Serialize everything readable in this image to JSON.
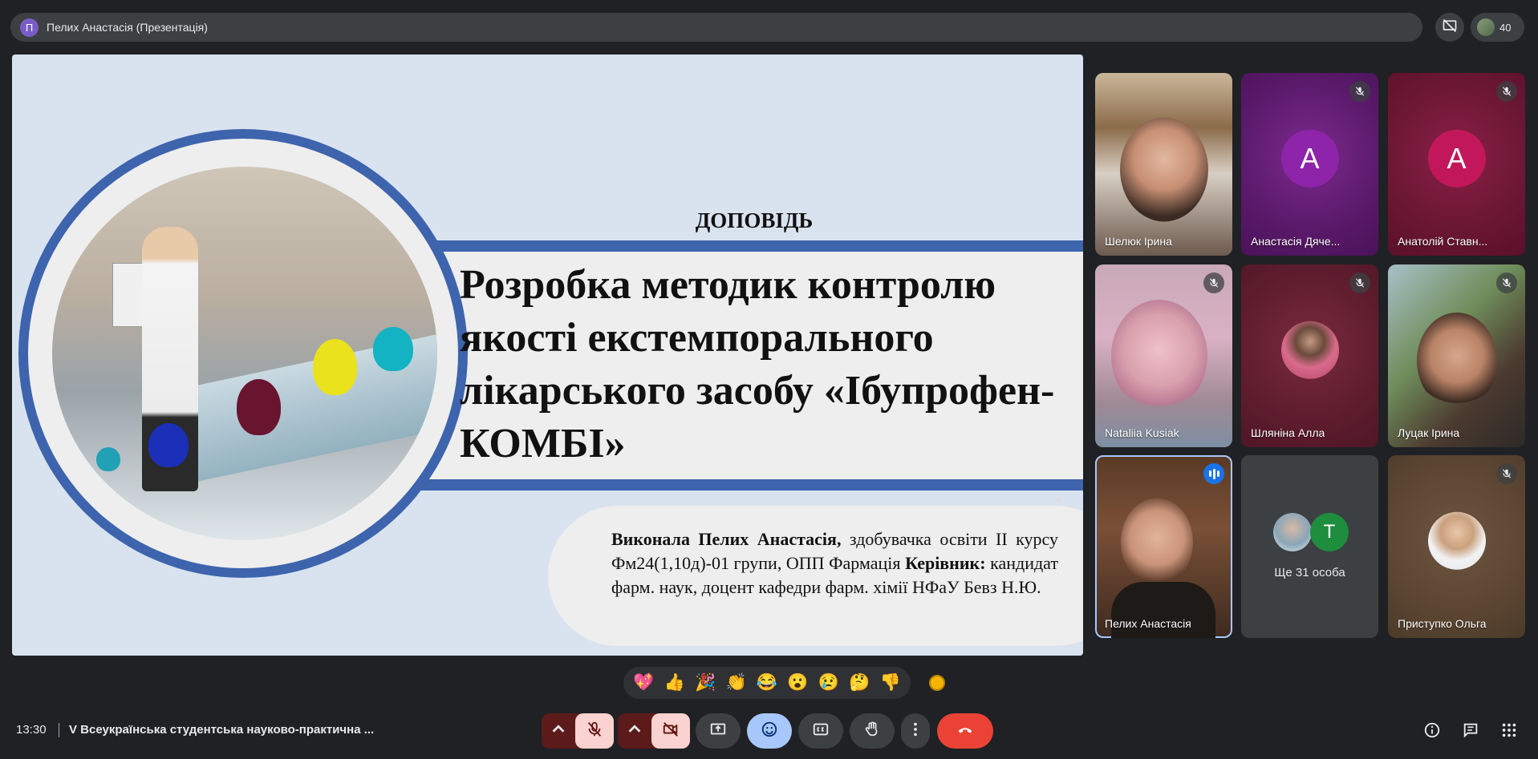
{
  "topbar": {
    "presenter_initial": "П",
    "title": "Пелих Анастасія (Презентація)",
    "participants_count": "40"
  },
  "slide": {
    "label": "ДОПОВІДЬ",
    "title": "Розробка методик контролю якості екстемпорального лікарського засобу «Ібупрофен-КОМБІ»",
    "author_bold": "Виконала Пелих Анастасія,",
    "author_rest": " здобувачка освіти ІІ курсу Фм24(1,10д)-01 групи, ОПП Фармація",
    "supervisor_bold": "Керівник:",
    "supervisor_rest": " кандидат фарм. наук, доцент кафедри фарм. хімії НФаУ Бевз Н.Ю."
  },
  "tiles": [
    {
      "name": "Шелюк Ірина"
    },
    {
      "name": "Анастасія Дяче...",
      "initial": "А",
      "bg": "#6a1b7a",
      "avatar": "#8e24aa"
    },
    {
      "name": "Анатолій Ставн...",
      "initial": "А",
      "bg": "#7a1d3d",
      "avatar": "#c2185b"
    },
    {
      "name": "Nataliia Kusiak"
    },
    {
      "name": "Шляніна Алла",
      "bg": "#6b2236"
    },
    {
      "name": "Луцак Ірина"
    },
    {
      "name": "Пелих Анастасія"
    },
    {
      "name": "Ще 31 особа",
      "initial": "T"
    },
    {
      "name": "Приступко Ольга",
      "bg": "#5c4632"
    }
  ],
  "reactions": [
    "💖",
    "👍",
    "🎉",
    "👏",
    "😂",
    "😮",
    "😢",
    "🤔",
    "👎"
  ],
  "bottombar": {
    "time": "13:30",
    "meeting_title": "V Всеукраїнська студентська науково-практична ..."
  },
  "colors": {
    "accent_band": "#3d64ad",
    "end_call": "#ea4335",
    "muted_bg": "#fad2cf",
    "active_blue": "#a8c7fa"
  }
}
